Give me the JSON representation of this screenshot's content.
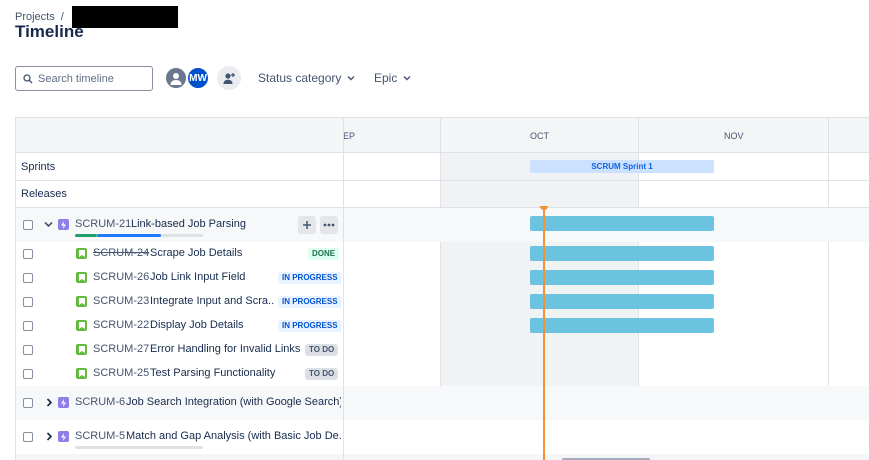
{
  "breadcrumb": {
    "projects": "Projects",
    "separator": "/"
  },
  "page_title": "Timeline",
  "toolbar": {
    "search_placeholder": "Search timeline",
    "avatar_initials": "MW",
    "status_filter": "Status category",
    "epic_filter": "Epic"
  },
  "months": [
    "EP",
    "OCT",
    "NOV"
  ],
  "rows": {
    "sprints": "Sprints",
    "releases": "Releases"
  },
  "sprint": {
    "name": "SCRUM Sprint 1"
  },
  "epics": [
    {
      "key": "SCRUM-21",
      "summary": "Link-based Job Parsing",
      "expanded": true
    },
    {
      "key": "SCRUM-6",
      "summary": "Job Search Integration (with Google Search)",
      "expanded": false
    },
    {
      "key": "SCRUM-5",
      "summary": "Match and Gap Analysis (with Basic Job De...",
      "expanded": false
    }
  ],
  "tasks": [
    {
      "key": "SCRUM-24",
      "summary": "Scrape Job Details",
      "status": "DONE"
    },
    {
      "key": "SCRUM-26",
      "summary": "Job Link Input Field",
      "status": "IN PROGRESS"
    },
    {
      "key": "SCRUM-23",
      "summary": "Integrate Input and Scra...",
      "status": "IN PROGRESS"
    },
    {
      "key": "SCRUM-22",
      "summary": "Display Job Details",
      "status": "IN PROGRESS"
    },
    {
      "key": "SCRUM-27",
      "summary": "Error Handling for Invalid Links",
      "status": "TO DO"
    },
    {
      "key": "SCRUM-25",
      "summary": "Test Parsing Functionality",
      "status": "TO DO"
    }
  ],
  "colors": {
    "bar": "#6cc3e0",
    "today_marker": "#f79233",
    "epic_icon": "#8f7ee7",
    "story_icon": "#63ba3c"
  },
  "icons": {
    "search": "search-icon",
    "expand": "chevron-down-icon",
    "collapse": "chevron-right-icon",
    "add": "plus-icon",
    "more": "more-icon",
    "add_people": "add-person-icon"
  }
}
